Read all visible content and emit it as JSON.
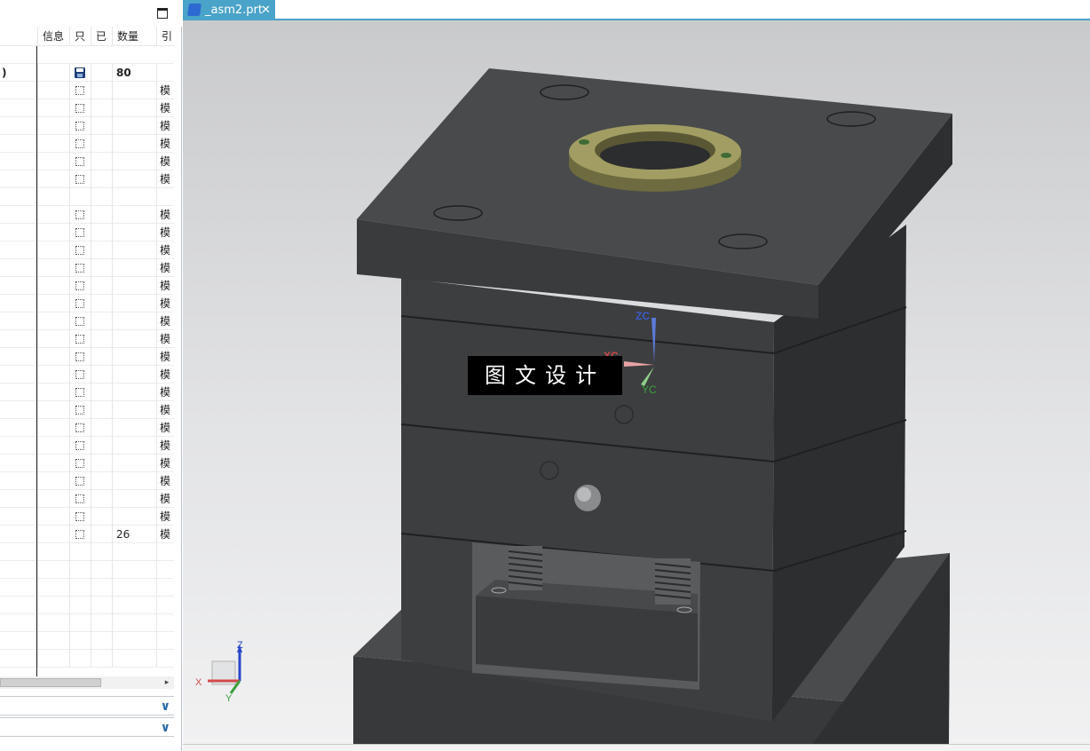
{
  "navigator": {
    "columns": [
      "信息",
      "只",
      "已",
      "数量",
      "引"
    ],
    "first_row": {
      "name": ")",
      "qty": "80"
    },
    "rows": [
      {
        "qty": "",
        "ref": "模",
        "cb": true
      },
      {
        "qty": "",
        "ref": "模",
        "cb": true
      },
      {
        "qty": "",
        "ref": "模",
        "cb": true
      },
      {
        "qty": "",
        "ref": "模",
        "cb": true
      },
      {
        "qty": "",
        "ref": "模",
        "cb": true
      },
      {
        "qty": "",
        "ref": "模",
        "cb": true
      },
      {
        "qty": "",
        "ref": "",
        "cb": false
      },
      {
        "qty": "",
        "ref": "模",
        "cb": true
      },
      {
        "qty": "",
        "ref": "模",
        "cb": true
      },
      {
        "qty": "",
        "ref": "模",
        "cb": true
      },
      {
        "qty": "",
        "ref": "模",
        "cb": true
      },
      {
        "qty": "",
        "ref": "模",
        "cb": true
      },
      {
        "qty": "",
        "ref": "模",
        "cb": true
      },
      {
        "qty": "",
        "ref": "模",
        "cb": true
      },
      {
        "qty": "",
        "ref": "模",
        "cb": true
      },
      {
        "qty": "",
        "ref": "模",
        "cb": true
      },
      {
        "qty": "",
        "ref": "模",
        "cb": true
      },
      {
        "qty": "",
        "ref": "模",
        "cb": true
      },
      {
        "qty": "",
        "ref": "模",
        "cb": true
      },
      {
        "qty": "",
        "ref": "模",
        "cb": true
      },
      {
        "qty": "",
        "ref": "模",
        "cb": true
      },
      {
        "qty": "",
        "ref": "模",
        "cb": true
      },
      {
        "qty": "",
        "ref": "模",
        "cb": true
      },
      {
        "qty": "",
        "ref": "模",
        "cb": true
      },
      {
        "qty": "",
        "ref": "模",
        "cb": true
      },
      {
        "qty": "26",
        "ref": "模",
        "cb": true
      },
      {
        "qty": "",
        "ref": "",
        "cb": false
      },
      {
        "qty": "",
        "ref": "",
        "cb": false
      },
      {
        "qty": "",
        "ref": "",
        "cb": false
      },
      {
        "qty": "",
        "ref": "",
        "cb": false
      },
      {
        "qty": "",
        "ref": "",
        "cb": false
      },
      {
        "qty": "",
        "ref": "",
        "cb": false
      },
      {
        "qty": "",
        "ref": "",
        "cb": false
      }
    ],
    "section_chevrons": [
      "v",
      "v"
    ]
  },
  "graphics": {
    "tab_label": "_asm2.prt",
    "tab_close": "✕",
    "wcs_labels": {
      "zc": "ZC",
      "xc": "XC",
      "yc": "YC"
    },
    "triad_labels": {
      "z": "Z",
      "x": "X",
      "y": "Y"
    },
    "watermark": "图文设计"
  },
  "colors": {
    "tab_accent": "#4aa3c8",
    "mold_body": "#3e3f41",
    "locating_ring": "#8d8a52"
  }
}
